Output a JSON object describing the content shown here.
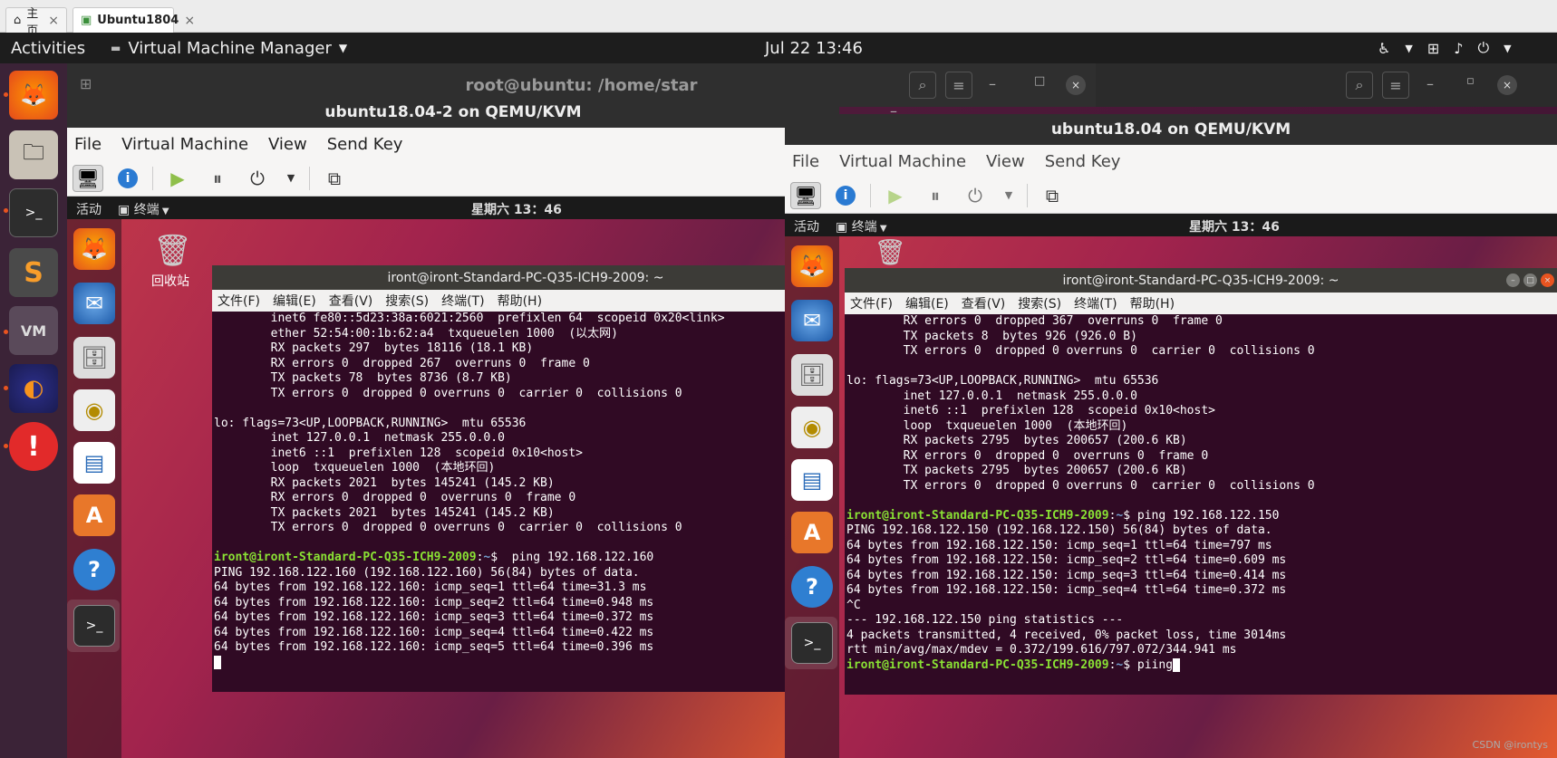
{
  "browser": {
    "tabs": [
      {
        "label": "主页"
      },
      {
        "label": "Ubuntu1804"
      }
    ]
  },
  "topbar": {
    "activities": "Activities",
    "app_menu": "Virtual Machine Manager",
    "clock": "Jul 22  13:46"
  },
  "host_terminal": {
    "title": "root@ubuntu: /home/star"
  },
  "vm_left": {
    "title": "ubuntu18.04-2 on QEMU/KVM",
    "menu": [
      "File",
      "Virtual Machine",
      "View",
      "Send Key"
    ],
    "guest": {
      "activities": "活动",
      "app": "终端",
      "clock": "星期六 13：46",
      "trash_label": "回收站",
      "terminal_title": "iront@iront-Standard-PC-Q35-ICH9-2009: ~",
      "terminal_menu": [
        "文件(F)",
        "编辑(E)",
        "查看(V)",
        "搜索(S)",
        "终端(T)",
        "帮助(H)"
      ],
      "lines": [
        "        inet6 fe80::5d23:38a:6021:2560  prefixlen 64  scopeid 0x20<link>",
        "        ether 52:54:00:1b:62:a4  txqueuelen 1000  (以太网)",
        "        RX packets 297  bytes 18116 (18.1 KB)",
        "        RX errors 0  dropped 267  overruns 0  frame 0",
        "        TX packets 78  bytes 8736 (8.7 KB)",
        "        TX errors 0  dropped 0 overruns 0  carrier 0  collisions 0",
        "",
        "lo: flags=73<UP,LOOPBACK,RUNNING>  mtu 65536",
        "        inet 127.0.0.1  netmask 255.0.0.0",
        "        inet6 ::1  prefixlen 128  scopeid 0x10<host>",
        "        loop  txqueuelen 1000  (本地环回)",
        "        RX packets 2021  bytes 145241 (145.2 KB)",
        "        RX errors 0  dropped 0  overruns 0  frame 0",
        "        TX packets 2021  bytes 145241 (145.2 KB)",
        "        TX errors 0  dropped 0 overruns 0  carrier 0  collisions 0",
        ""
      ],
      "prompt_user": "iront@iront-Standard-PC-Q35-ICH9-2009",
      "prompt_path": "~",
      "prompt_cmd": "$  ping 192.168.122.160",
      "out_lines": [
        "PING 192.168.122.160 (192.168.122.160) 56(84) bytes of data.",
        "64 bytes from 192.168.122.160: icmp_seq=1 ttl=64 time=31.3 ms",
        "64 bytes from 192.168.122.160: icmp_seq=2 ttl=64 time=0.948 ms",
        "64 bytes from 192.168.122.160: icmp_seq=3 ttl=64 time=0.372 ms",
        "64 bytes from 192.168.122.160: icmp_seq=4 ttl=64 time=0.422 ms",
        "64 bytes from 192.168.122.160: icmp_seq=5 ttl=64 time=0.396 ms"
      ]
    }
  },
  "vm_right": {
    "title": "ubuntu18.04 on QEMU/KVM",
    "menu": [
      "File",
      "Virtual Machine",
      "View",
      "Send Key"
    ],
    "guest": {
      "activities": "活动",
      "app": "终端",
      "clock": "星期六 13：46",
      "terminal_title": "iront@iront-Standard-PC-Q35-ICH9-2009: ~",
      "terminal_menu": [
        "文件(F)",
        "编辑(E)",
        "查看(V)",
        "搜索(S)",
        "终端(T)",
        "帮助(H)"
      ],
      "lines": [
        "        RX errors 0  dropped 367  overruns 0  frame 0",
        "        TX packets 8  bytes 926 (926.0 B)",
        "        TX errors 0  dropped 0 overruns 0  carrier 0  collisions 0",
        "",
        "lo: flags=73<UP,LOOPBACK,RUNNING>  mtu 65536",
        "        inet 127.0.0.1  netmask 255.0.0.0",
        "        inet6 ::1  prefixlen 128  scopeid 0x10<host>",
        "        loop  txqueuelen 1000  (本地环回)",
        "        RX packets 2795  bytes 200657 (200.6 KB)",
        "        RX errors 0  dropped 0  overruns 0  frame 0",
        "        TX packets 2795  bytes 200657 (200.6 KB)",
        "        TX errors 0  dropped 0 overruns 0  carrier 0  collisions 0",
        ""
      ],
      "prompt_user": "iront@iront-Standard-PC-Q35-ICH9-2009",
      "prompt_path": "~",
      "prompt_cmd": "$ ping 192.168.122.150",
      "out_lines": [
        "PING 192.168.122.150 (192.168.122.150) 56(84) bytes of data.",
        "64 bytes from 192.168.122.150: icmp_seq=1 ttl=64 time=797 ms",
        "64 bytes from 192.168.122.150: icmp_seq=2 ttl=64 time=0.609 ms",
        "64 bytes from 192.168.122.150: icmp_seq=3 ttl=64 time=0.414 ms",
        "64 bytes from 192.168.122.150: icmp_seq=4 ttl=64 time=0.372 ms",
        "^C",
        "--- 192.168.122.150 ping statistics ---",
        "4 packets transmitted, 4 received, 0% packet loss, time 3014ms",
        "rtt min/avg/max/mdev = 0.372/199.616/797.072/344.941 ms"
      ],
      "last_cmd": "$ piing"
    }
  },
  "watermark": "CSDN @irontys",
  "colors": {
    "accent": "#e95420",
    "terminal_bg": "#300a24",
    "prompt_green": "#8ae234",
    "prompt_blue": "#729fcf"
  }
}
